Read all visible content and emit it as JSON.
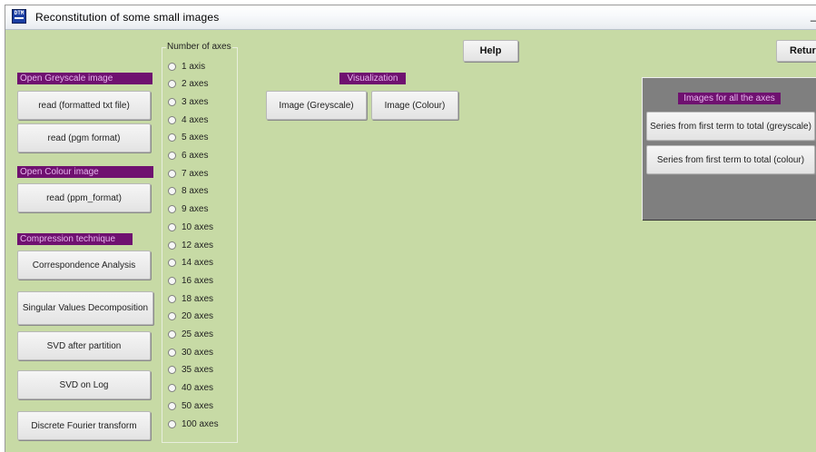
{
  "window": {
    "title": "Reconstitution of some small images",
    "minimize_glyph": "_",
    "app_icon": "dtm-app-icon",
    "app_icon_text": "DTM"
  },
  "colors": {
    "background": "#c7daa5",
    "label_background": "#6f1170",
    "label_text": "#e7b6ee",
    "panel_gray": "#7f7f7f"
  },
  "top_buttons": {
    "help": "Help",
    "return": "Return"
  },
  "open_greyscale": {
    "label": "Open Greyscale image",
    "buttons": [
      "read (formatted txt file)",
      "read (pgm format)"
    ]
  },
  "open_colour": {
    "label": "Open Colour image",
    "buttons": [
      "read (ppm_format)"
    ]
  },
  "compression": {
    "label": "Compression technique",
    "buttons": [
      "Correspondence Analysis",
      "Singular Values Decomposition",
      "SVD after partition",
      "SVD on Log",
      "Discrete Fourier transform"
    ]
  },
  "number_of_axes": {
    "legend": "Number of axes",
    "options": [
      "1 axis",
      "2 axes",
      "3 axes",
      "4 axes",
      "5 axes",
      "6 axes",
      "7 axes",
      "8 axes",
      "9 axes",
      "10 axes",
      "12 axes",
      "14 axes",
      "16 axes",
      "18 axes",
      "20 axes",
      "25 axes",
      "30 axes",
      "35 axes",
      "40 axes",
      "50 axes",
      "100 axes"
    ]
  },
  "visualization": {
    "label": "Visualization",
    "greyscale": "Image (Greyscale)",
    "colour": "Image (Colour)"
  },
  "all_axes": {
    "label": "Images for all the axes",
    "greyscale": "Series from first term to total (greyscale)",
    "colour": "Series from first term to total (colour)"
  }
}
